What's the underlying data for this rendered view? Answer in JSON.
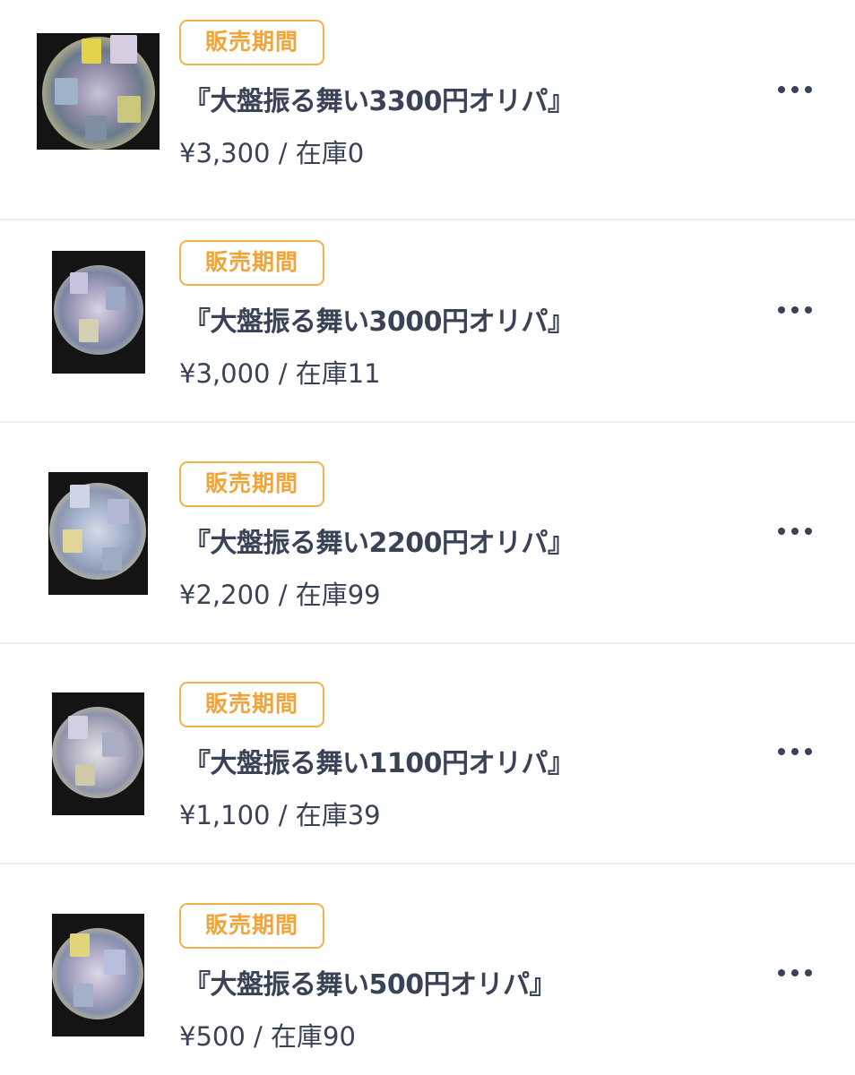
{
  "items": [
    {
      "badge": "販売期間",
      "title": "『大盤振る舞い3300円オリパ』",
      "price": "¥3,300",
      "separator": " / ",
      "stock": "在庫0",
      "more_icon": "more-horizontal-icon"
    },
    {
      "badge": "販売期間",
      "title": "『大盤振る舞い3000円オリパ』",
      "price": "¥3,000",
      "separator": " / ",
      "stock": "在庫11",
      "more_icon": "more-horizontal-icon"
    },
    {
      "badge": "販売期間",
      "title": "『大盤振る舞い2200円オリパ』",
      "price": "¥2,200",
      "separator": " / ",
      "stock": "在庫99",
      "more_icon": "more-horizontal-icon"
    },
    {
      "badge": "販売期間",
      "title": "『大盤振る舞い1100円オリパ』",
      "price": "¥1,100",
      "separator": " / ",
      "stock": "在庫39",
      "more_icon": "more-horizontal-icon"
    },
    {
      "badge": "販売期間",
      "title": "『大盤振る舞い500円オリパ』",
      "price": "¥500",
      "separator": " / ",
      "stock": "在庫90",
      "more_icon": "more-horizontal-icon"
    }
  ],
  "colors": {
    "badge_border": "#f2b24a",
    "badge_text": "#efa53c",
    "text": "#3a4256",
    "divider": "#eceef2"
  }
}
